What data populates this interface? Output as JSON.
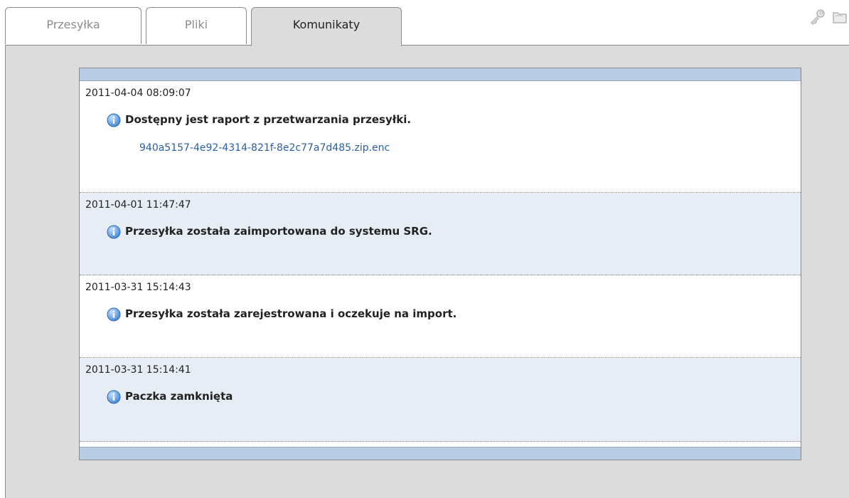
{
  "tabs": [
    {
      "label": "Przesyłka",
      "active": false
    },
    {
      "label": "Pliki",
      "active": false
    },
    {
      "label": "Komunikaty",
      "active": true
    }
  ],
  "toolbar_icons": [
    "key-icon",
    "folder-icon"
  ],
  "messages": [
    {
      "timestamp": "2011-04-04 08:09:07",
      "text": "Dostępny jest raport z przetwarzania przesyłki.",
      "link": "940a5157-4e92-4314-821f-8e2c77a7d485.zip.enc",
      "icon": "info-icon"
    },
    {
      "timestamp": "2011-04-01 11:47:47",
      "text": "Przesyłka została zaimportowana do systemu SRG.",
      "icon": "info-icon"
    },
    {
      "timestamp": "2011-03-31 15:14:43",
      "text": "Przesyłka została zarejestrowana i oczekuje na import.",
      "icon": "info-icon"
    },
    {
      "timestamp": "2011-03-31 15:14:41",
      "text": "Paczka zamknięta",
      "icon": "info-icon"
    }
  ],
  "colors": {
    "header_bar": "#b9cde5",
    "row_alt": "#e7edf5",
    "panel": "#dcdcdc",
    "link": "#2a5fa8",
    "info_icon": "#4a8fd6"
  }
}
